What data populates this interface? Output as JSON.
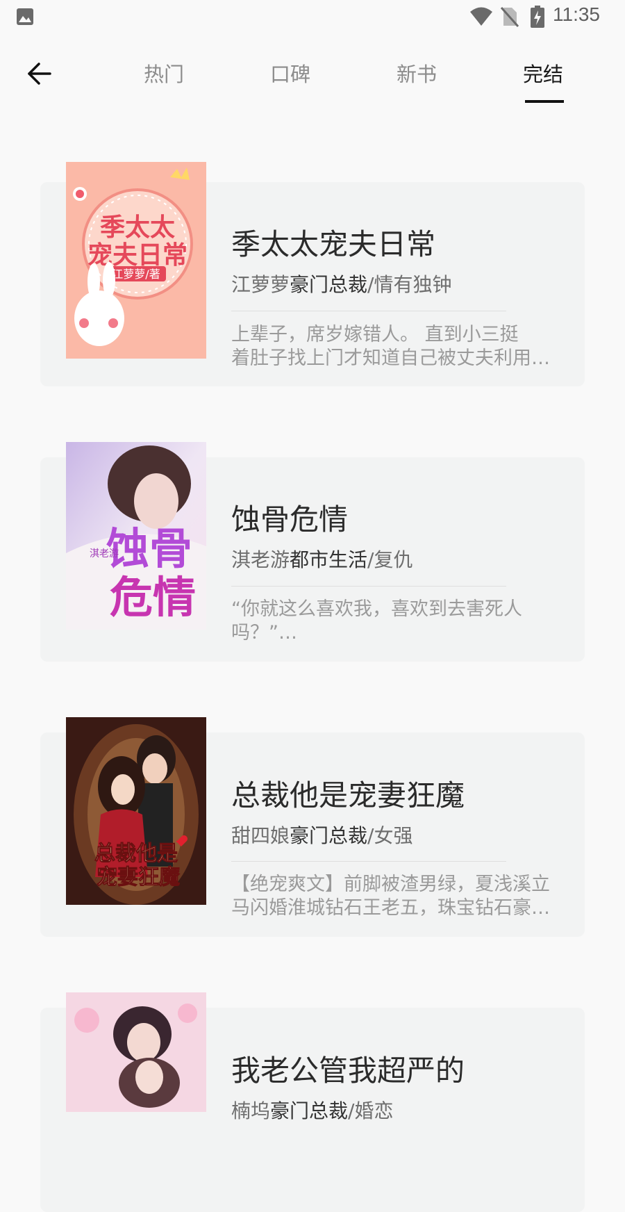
{
  "status_bar": {
    "time": "11:35",
    "icons": [
      "gallery-icon",
      "wifi-icon",
      "no-sim-icon",
      "battery-charging-icon"
    ]
  },
  "nav": {
    "back_icon": "arrow-left-icon",
    "tabs": [
      {
        "label": "热门",
        "active": false
      },
      {
        "label": "口碑",
        "active": false
      },
      {
        "label": "新书",
        "active": false
      },
      {
        "label": "完结",
        "active": true
      }
    ]
  },
  "books": [
    {
      "title": "季太太宠夫日常",
      "author": "江萝萝",
      "genre": "豪门总裁",
      "tag": "/情有独钟",
      "desc_line1": "上辈子，席岁嫁错人。 直到小三挺",
      "desc_line2": "着肚子找上门才知道自己被丈夫利用…",
      "cover": {
        "line1": "季太太",
        "line2": "宠夫日常",
        "author": "江萝萝/著"
      }
    },
    {
      "title": "蚀骨危情",
      "author": "淇老游",
      "genre": "都市生活",
      "tag": "/复仇",
      "desc_line1": "“你就这么喜欢我，喜欢到去害死人",
      "desc_line2": "吗？”…",
      "cover": {
        "line1": "蚀骨",
        "line2": "危情",
        "author": "淇老游"
      }
    },
    {
      "title": "总裁他是宠妻狂魔",
      "author": "甜四娘",
      "genre": "豪门总裁",
      "tag": "/女强",
      "desc_line1": "【绝宠爽文】前脚被渣男绿，夏浅溪立",
      "desc_line2": "马闪婚淮城钻石王老五，珠宝钻石豪…",
      "cover": {
        "line1": "总裁他是",
        "line2": "宠妻狂魔",
        "author": ""
      }
    },
    {
      "title": "我老公管我超严的",
      "author": "楠坞",
      "genre": "豪门总裁",
      "tag": "/婚恋",
      "desc_line1": "",
      "desc_line2": "",
      "cover": {
        "line1": "",
        "line2": "",
        "author": ""
      }
    }
  ]
}
